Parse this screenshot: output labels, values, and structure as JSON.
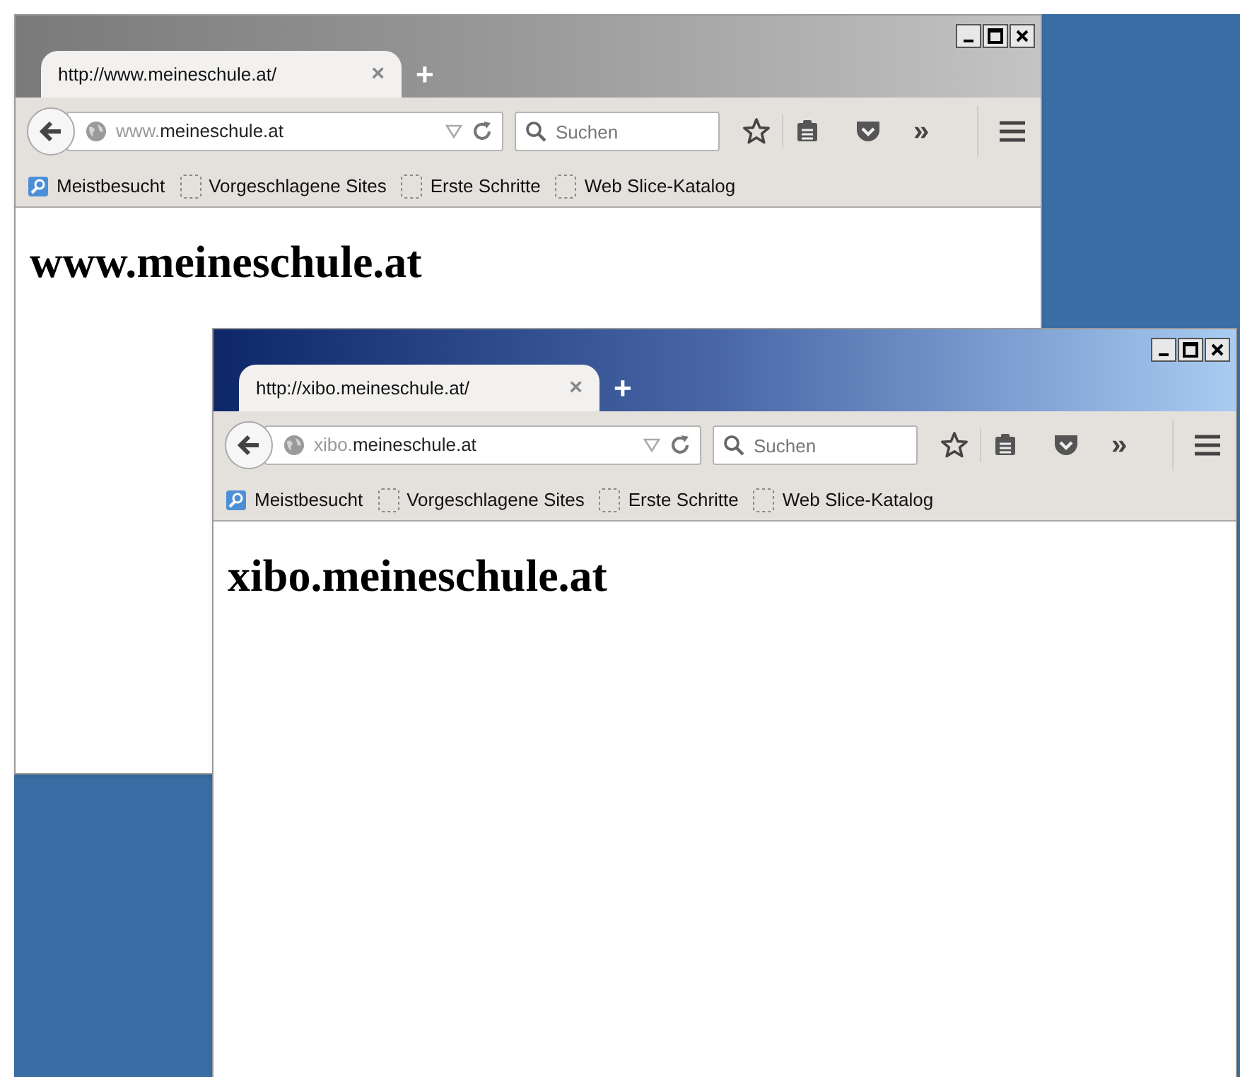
{
  "windows": [
    {
      "active": false,
      "tab": {
        "title": "http://www.meineschule.at/",
        "close": "×",
        "new_tab": "+"
      },
      "address": {
        "prefix": "www.",
        "domain": "meineschule.at"
      },
      "search": {
        "placeholder": "Suchen"
      },
      "overflow": "»",
      "bookmarks": [
        {
          "kind": "smart",
          "label": "Meistbesucht"
        },
        {
          "kind": "blank",
          "label": "Vorgeschlagene Sites"
        },
        {
          "kind": "blank",
          "label": "Erste Schritte"
        },
        {
          "kind": "blank",
          "label": "Web Slice-Katalog"
        }
      ],
      "heading": "www.meineschule.at"
    },
    {
      "active": true,
      "tab": {
        "title": "http://xibo.meineschule.at/",
        "close": "×",
        "new_tab": "+"
      },
      "address": {
        "prefix": "xibo.",
        "domain": "meineschule.at"
      },
      "search": {
        "placeholder": "Suchen"
      },
      "overflow": "»",
      "bookmarks": [
        {
          "kind": "smart",
          "label": "Meistbesucht"
        },
        {
          "kind": "blank",
          "label": "Vorgeschlagene Sites"
        },
        {
          "kind": "blank",
          "label": "Erste Schritte"
        },
        {
          "kind": "blank",
          "label": "Web Slice-Katalog"
        }
      ],
      "heading": "xibo.meineschule.at"
    }
  ]
}
